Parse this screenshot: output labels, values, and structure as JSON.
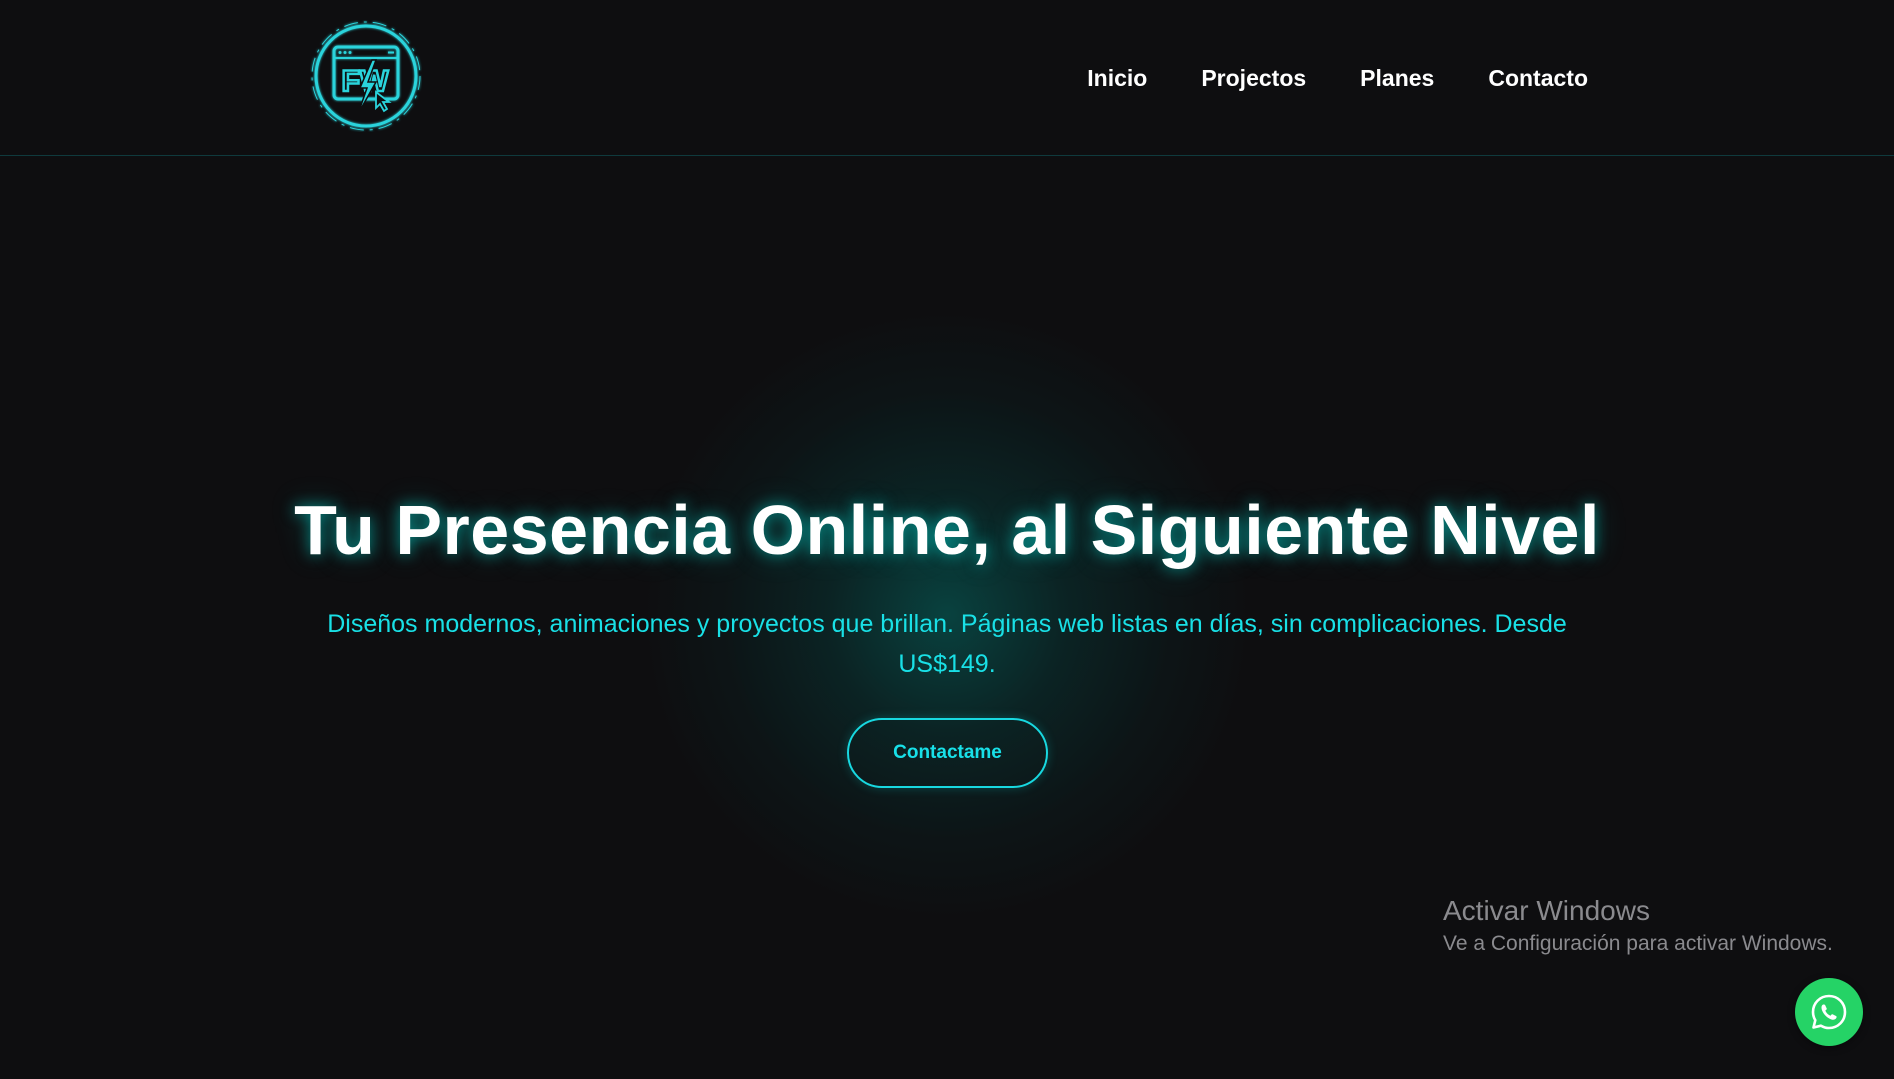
{
  "header": {
    "logo": {
      "icon": "fw-logo-icon",
      "text": "FW"
    },
    "nav": [
      {
        "label": "Inicio"
      },
      {
        "label": "Projectos"
      },
      {
        "label": "Planes"
      },
      {
        "label": "Contacto"
      }
    ]
  },
  "hero": {
    "title": "Tu Presencia Online, al Siguiente Nivel",
    "subtitle": "Diseños modernos, animaciones y proyectos que brillan. Páginas web listas en días, sin complicaciones. Desde US$149.",
    "cta_label": "Contactame"
  },
  "watermark": {
    "title": "Activar Windows",
    "subtitle": "Ve a Configuración para activar Windows."
  },
  "floating": {
    "whatsapp_icon": "whatsapp-icon"
  },
  "colors": {
    "background": "#0e0e10",
    "accent": "#19e0e6",
    "whatsapp": "#25d366"
  }
}
